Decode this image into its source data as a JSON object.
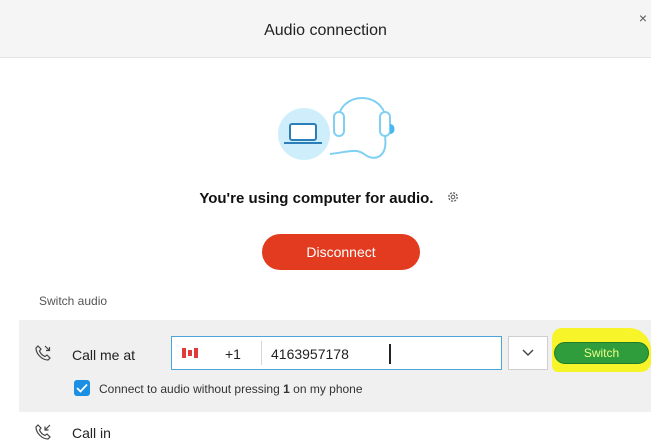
{
  "header": {
    "title": "Audio connection",
    "close_glyph": "×"
  },
  "status": {
    "text": "You're using computer for audio.",
    "settings_icon": "gear-icon"
  },
  "disconnect": {
    "label": "Disconnect",
    "color": "#e23b20"
  },
  "switch_audio": {
    "heading": "Switch audio"
  },
  "call_me": {
    "label": "Call me at",
    "country_flag": "canada-flag-icon",
    "country_code": "+1",
    "phone_number": "4163957178",
    "switch_label": "Switch",
    "switch_color": "#2f9d3b",
    "highlight_color": "#f8f42a",
    "auto_connect": {
      "checked": true,
      "text_before": "Connect to audio without pressing ",
      "text_bold": "1",
      "text_after": " on my phone"
    }
  },
  "call_in": {
    "label": "Call in"
  },
  "colors": {
    "accent_blue": "#1a8fe3",
    "header_bg": "#f5f5f5",
    "row_bg": "#f0f0f0"
  }
}
